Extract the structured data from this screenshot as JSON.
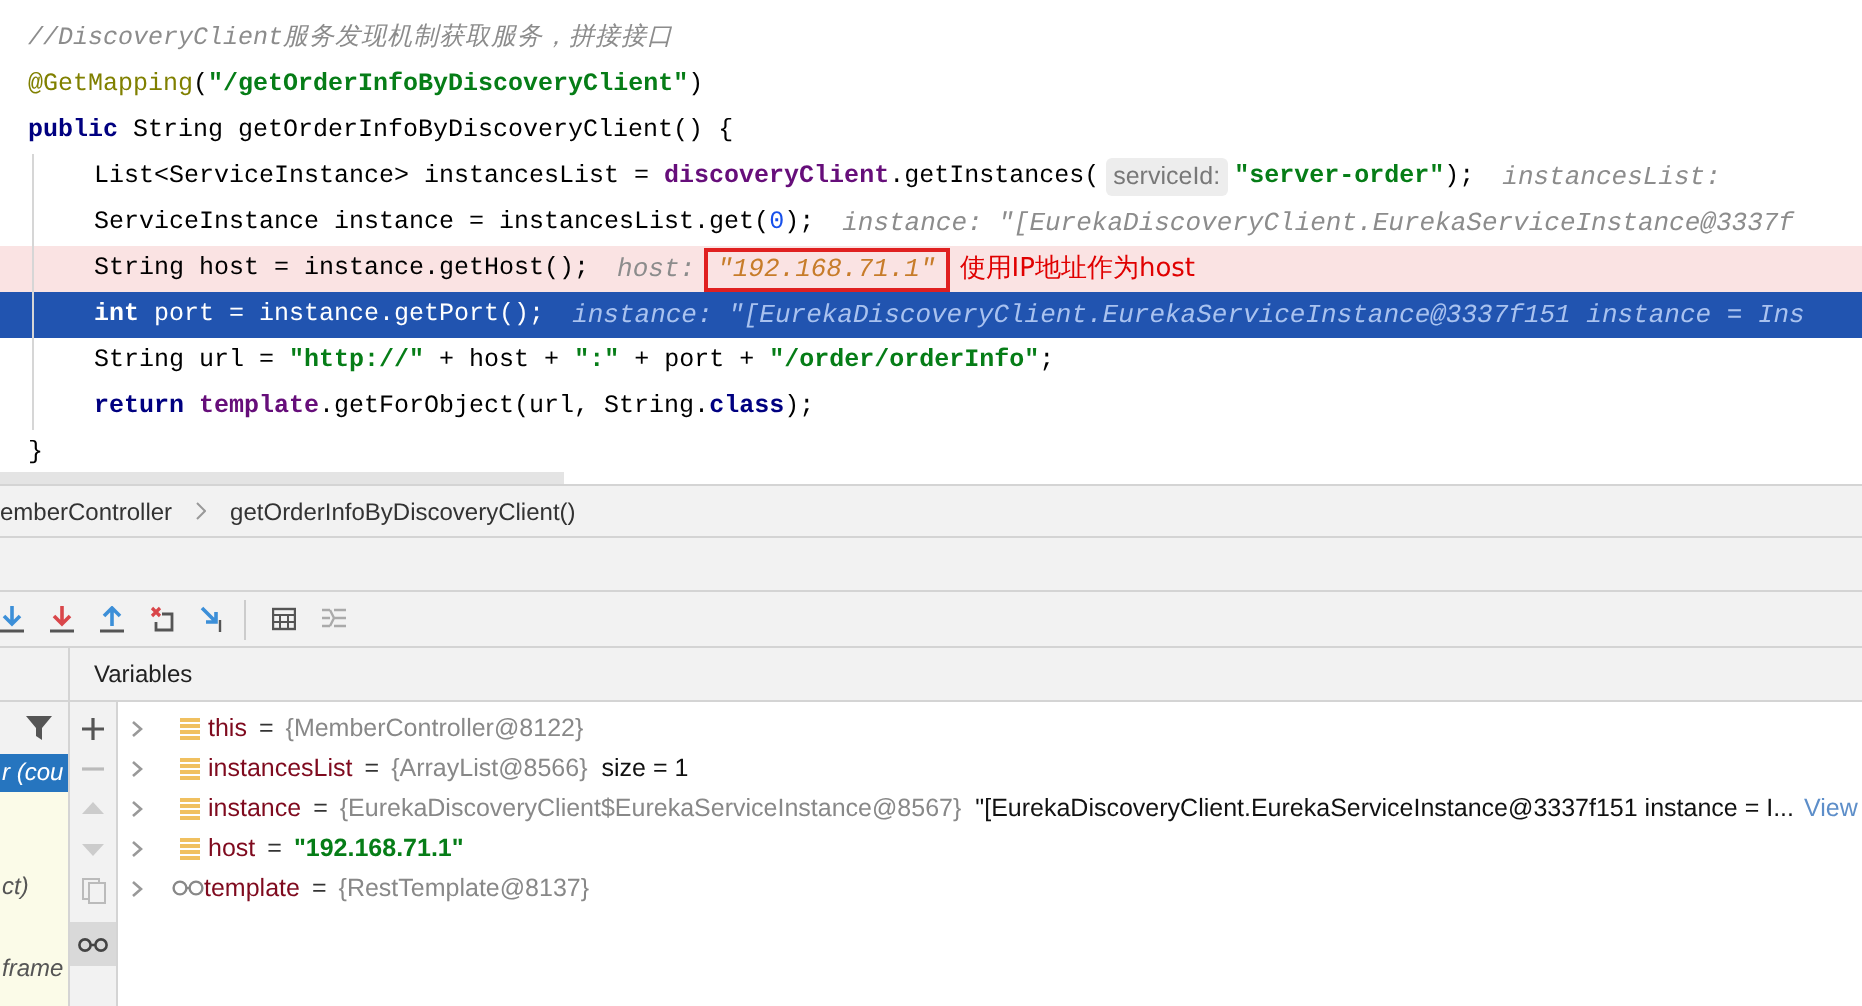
{
  "code_lines": [
    {
      "kind": "normal",
      "indent": false,
      "tokens": [
        {
          "kind": "comment",
          "text": "//DiscoveryClient服务发现机制获取服务，拼接接口"
        }
      ]
    },
    {
      "kind": "normal",
      "indent": false,
      "tokens": [
        {
          "kind": "annotation",
          "text": "@GetMapping"
        },
        {
          "kind": "plain",
          "text": "("
        },
        {
          "kind": "string",
          "text": "\"/getOrderInfoByDiscoveryClient\""
        },
        {
          "kind": "plain",
          "text": ")"
        }
      ]
    },
    {
      "kind": "normal",
      "indent": false,
      "tokens": [
        {
          "kind": "keyword",
          "text": "public"
        },
        {
          "kind": "plain",
          "text": " String getOrderInfoByDiscoveryClient() {"
        }
      ]
    },
    {
      "kind": "normal",
      "indent": true,
      "tokens": [
        {
          "kind": "plain",
          "text": "List<ServiceInstance> instancesList = "
        },
        {
          "kind": "field",
          "text": "discoveryClient"
        },
        {
          "kind": "plain",
          "text": ".getInstances("
        },
        {
          "kind": "param-hint",
          "text": "serviceId:"
        },
        {
          "kind": "string",
          "text": "\"server-order\""
        },
        {
          "kind": "plain",
          "text": ");"
        },
        {
          "kind": "inline-value",
          "text": "instancesList:"
        }
      ]
    },
    {
      "kind": "normal",
      "indent": true,
      "tokens": [
        {
          "kind": "plain",
          "text": "ServiceInstance instance = instancesList.get("
        },
        {
          "kind": "number",
          "text": "0"
        },
        {
          "kind": "plain",
          "text": ");"
        },
        {
          "kind": "inline-value",
          "text": "instance: \"[EurekaDiscoveryClient.EurekaServiceInstance@3337f"
        }
      ]
    },
    {
      "kind": "breakpoint",
      "indent": true,
      "tokens": [
        {
          "kind": "plain",
          "text": "String host = instance.getHost();"
        },
        {
          "kind": "inline-value",
          "text": "host:"
        },
        {
          "kind": "boxed-value",
          "text": "\"192.168.71.1\""
        },
        {
          "kind": "note",
          "text": "使用IP地址作为host"
        }
      ]
    },
    {
      "kind": "current",
      "indent": true,
      "tokens": [
        {
          "kind": "keyword",
          "text": "int"
        },
        {
          "kind": "plain",
          "text": " port = instance.getPort();"
        },
        {
          "kind": "inline-value",
          "text": "instance: \"[EurekaDiscoveryClient.EurekaServiceInstance@3337f151 instance = Ins"
        }
      ]
    },
    {
      "kind": "normal",
      "indent": true,
      "tokens": [
        {
          "kind": "plain",
          "text": "String url = "
        },
        {
          "kind": "string",
          "text": "\"http://\""
        },
        {
          "kind": "plain",
          "text": " + host + "
        },
        {
          "kind": "string",
          "text": "\":\""
        },
        {
          "kind": "plain",
          "text": " + port + "
        },
        {
          "kind": "string",
          "text": "\"/order/orderInfo\""
        },
        {
          "kind": "plain",
          "text": ";"
        }
      ]
    },
    {
      "kind": "normal",
      "indent": true,
      "tokens": [
        {
          "kind": "keyword",
          "text": "return"
        },
        {
          "kind": "field",
          "text": "template"
        },
        {
          "kind": "plain",
          "text": ".getForObject(url, String."
        },
        {
          "kind": "keyword",
          "text": "class"
        },
        {
          "kind": "plain",
          "text": ");"
        }
      ]
    },
    {
      "kind": "normal",
      "indent": false,
      "tokens": [
        {
          "kind": "plain",
          "text": "}"
        }
      ]
    }
  ],
  "breadcrumb": [
    "emberController",
    "getOrderInfoByDiscoveryClient()"
  ],
  "frames": [
    {
      "text": "r (cou",
      "selected": true
    },
    {
      "text": "ct)",
      "selected": false
    },
    {
      "text": "frame",
      "selected": false
    }
  ],
  "variables_title": "Variables",
  "variables": [
    {
      "kind": "field",
      "expanded": false,
      "name": "this",
      "operator": "=",
      "value": "{MemberController@8122}"
    },
    {
      "kind": "field",
      "expanded": false,
      "name": "instancesList",
      "operator": "=",
      "value": "{ArrayList@8566}",
      "extra": "size = 1"
    },
    {
      "kind": "field",
      "expanded": false,
      "name": "instance",
      "operator": "=",
      "value": "{EurekaDiscoveryClient$EurekaServiceInstance@8567}",
      "extra": "\"[EurekaDiscoveryClient.EurekaServiceInstance@3337f151 instance = I...",
      "link": "View"
    },
    {
      "kind": "string-field",
      "expanded": false,
      "name": "host",
      "operator": "=",
      "value": "\"192.168.71.1\""
    },
    {
      "kind": "watch",
      "expanded": false,
      "name": "template",
      "operator": "=",
      "value": "{RestTemplate@8137}"
    }
  ]
}
